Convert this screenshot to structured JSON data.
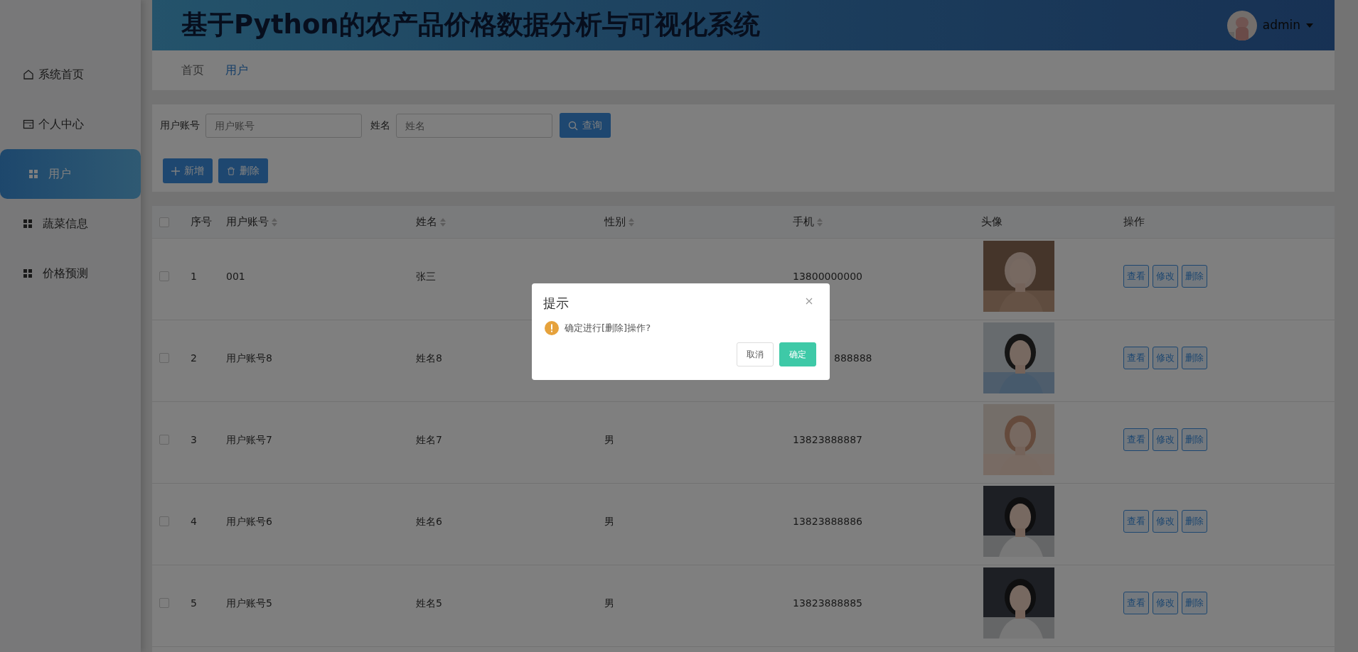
{
  "header": {
    "title": "基于Python的农产品价格数据分析与可视化系统",
    "user": {
      "name": "admin"
    }
  },
  "sidebar": {
    "items": [
      {
        "label": "系统首页",
        "selected": false
      },
      {
        "label": "个人中心",
        "selected": false
      },
      {
        "label": "用户",
        "selected": true
      },
      {
        "label": "蔬菜信息",
        "selected": false
      },
      {
        "label": "价格预测",
        "selected": false
      }
    ]
  },
  "breadcrumb": [
    {
      "label": "首页",
      "selected": false
    },
    {
      "label": "用户",
      "selected": true
    }
  ],
  "search": {
    "fields": [
      {
        "label": "用户账号",
        "placeholder": "用户账号"
      },
      {
        "label": "姓名",
        "placeholder": "姓名"
      }
    ],
    "button": "查询"
  },
  "actions": [
    {
      "label": "新增"
    },
    {
      "label": "删除"
    }
  ],
  "table": {
    "all_checked": false,
    "columns": [
      {
        "label": "序号",
        "sortable": false
      },
      {
        "label": "用户账号",
        "sortable": true
      },
      {
        "label": "姓名",
        "sortable": true
      },
      {
        "label": "性别",
        "sortable": true
      },
      {
        "label": "手机",
        "sortable": true
      },
      {
        "label": "头像",
        "sortable": false
      },
      {
        "label": "操作",
        "sortable": false
      }
    ],
    "rows": [
      {
        "index": "1",
        "account": "001",
        "name": "张三",
        "phone": "13800000000",
        "checked": false,
        "buttons": [
          "查看",
          "修改",
          "删除"
        ]
      },
      {
        "index": "2",
        "account": "用户账号8",
        "name": "姓名8",
        "phone": "888888",
        "phone_clipped": true,
        "checked": false,
        "buttons": [
          "查看",
          "修改",
          "删除"
        ]
      },
      {
        "index": "3",
        "account": "用户账号7",
        "name": "姓名7",
        "gender": "男",
        "phone": "13823888887",
        "checked": false,
        "buttons": [
          "查看",
          "修改",
          "删除"
        ]
      },
      {
        "index": "4",
        "account": "用户账号6",
        "name": "姓名6",
        "gender": "男",
        "phone": "13823888886",
        "checked": false,
        "buttons": [
          "查看",
          "修改",
          "删除"
        ]
      },
      {
        "index": "5",
        "account": "用户账号5",
        "name": "姓名5",
        "gender": "男",
        "phone": "13823888885",
        "checked": false,
        "buttons": [
          "查看",
          "修改",
          "删除"
        ]
      }
    ]
  },
  "dialog": {
    "title": "提示",
    "message": "确定进行[删除]操作?",
    "buttons": [
      {
        "label": "取消",
        "kind": "default"
      },
      {
        "label": "确定",
        "kind": "primary"
      }
    ]
  }
}
